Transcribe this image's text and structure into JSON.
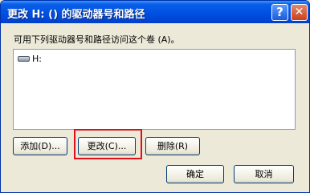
{
  "window": {
    "title": "更改 H: () 的驱动器号和路径",
    "help_label": "?",
    "close_label": "✕"
  },
  "dialog": {
    "description": "可用下列驱动器号和路径访问这个卷 (A)。",
    "list_items": [
      {
        "label": "H:",
        "icon": "drive-icon"
      }
    ]
  },
  "buttons": {
    "add": "添加(D)...",
    "change": "更改(C)...",
    "remove": "删除(R)",
    "ok": "确定",
    "cancel": "取消"
  },
  "colors": {
    "titlebar": "#0055e5",
    "dialog_bg": "#ece9d8",
    "highlight": "#e0101a"
  }
}
